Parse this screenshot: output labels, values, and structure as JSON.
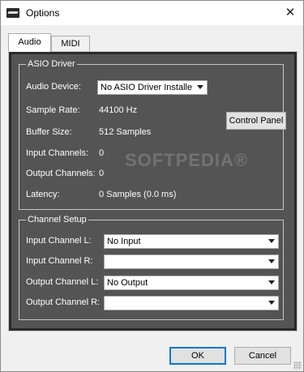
{
  "window": {
    "title": "Options",
    "close_glyph": "✕"
  },
  "tabs": [
    {
      "label": "Audio",
      "selected": true
    },
    {
      "label": "MIDI",
      "selected": false
    }
  ],
  "asio": {
    "legend": "ASIO Driver",
    "audio_device_label": "Audio Device:",
    "audio_device_value": "No ASIO Driver Installed",
    "sample_rate_label": "Sample Rate:",
    "sample_rate_value": "44100 Hz",
    "control_panel_label": "Control Panel",
    "buffer_size_label": "Buffer Size:",
    "buffer_size_value": "512 Samples",
    "input_channels_label": "Input Channels:",
    "input_channels_value": "0",
    "output_channels_label": "Output Channels:",
    "output_channels_value": "0",
    "latency_label": "Latency:",
    "latency_value": "0 Samples (0.0 ms)"
  },
  "channel_setup": {
    "legend": "Channel Setup",
    "input_l_label": "Input Channel L:",
    "input_l_value": "No Input",
    "input_r_label": "Input Channel R:",
    "input_r_value": "",
    "output_l_label": "Output Channel L:",
    "output_l_value": "No Output",
    "output_r_label": "Output Channel R:",
    "output_r_value": ""
  },
  "buttons": {
    "ok": "OK",
    "cancel": "Cancel"
  },
  "watermark": "SOFTPEDIA®",
  "colors": {
    "panel_bg": "#545454",
    "panel_dark": "#2b2b2b",
    "accent": "#0078d7"
  }
}
